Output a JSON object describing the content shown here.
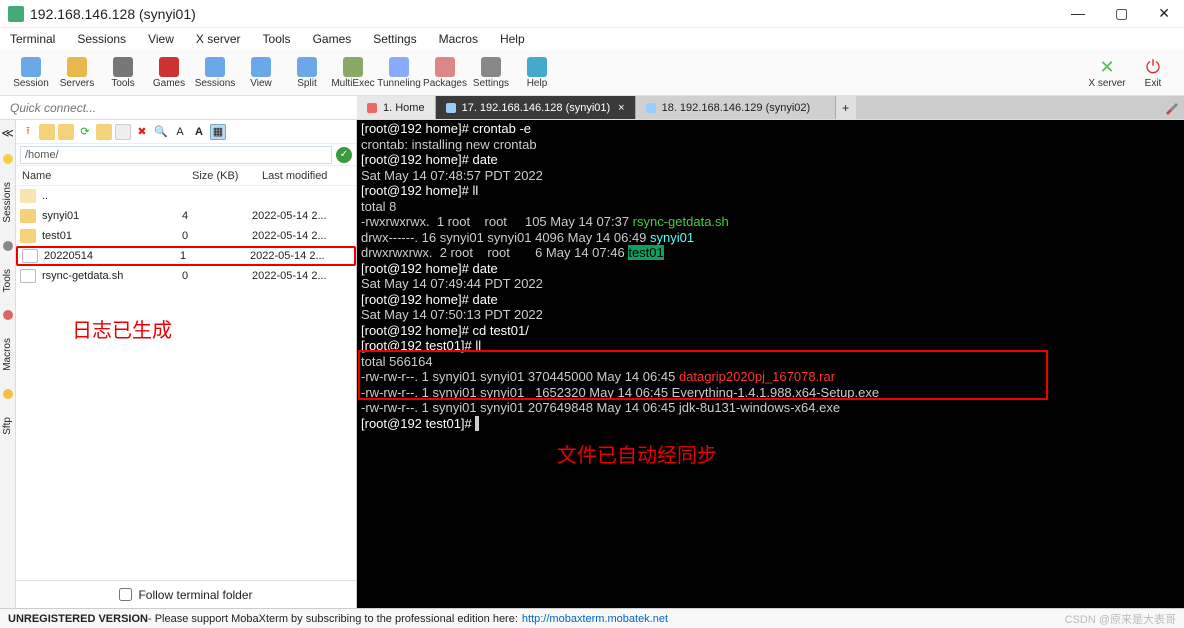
{
  "window": {
    "title": "192.168.146.128 (synyi01)"
  },
  "win_controls": {
    "min": "—",
    "max": "▢",
    "close": "✕"
  },
  "menu": {
    "terminal": "Terminal",
    "sessions": "Sessions",
    "view": "View",
    "xserver": "X server",
    "tools": "Tools",
    "games": "Games",
    "settings": "Settings",
    "macros": "Macros",
    "help": "Help"
  },
  "toolbar": {
    "items": [
      {
        "label": "Session",
        "color": "#6aa8e8"
      },
      {
        "label": "Servers",
        "color": "#e8b84a"
      },
      {
        "label": "Tools",
        "color": "#777"
      },
      {
        "label": "Games",
        "color": "#c33"
      },
      {
        "label": "Sessions",
        "color": "#6aa8e8"
      },
      {
        "label": "View",
        "color": "#6aa8e8"
      },
      {
        "label": "Split",
        "color": "#6aa8e8"
      },
      {
        "label": "MultiExec",
        "color": "#8a6"
      },
      {
        "label": "Tunneling",
        "color": "#8af"
      },
      {
        "label": "Packages",
        "color": "#d88"
      },
      {
        "label": "Settings",
        "color": "#888"
      },
      {
        "label": "Help",
        "color": "#4ac"
      }
    ],
    "right": [
      {
        "label": "X server",
        "color": "#5b5"
      },
      {
        "label": "Exit",
        "color": "#d33"
      }
    ]
  },
  "quick_connect": {
    "placeholder": "Quick connect..."
  },
  "tabs": {
    "home": "1. Home",
    "t1": "17. 192.168.146.128 (synyi01)",
    "t2": "18. 192.168.146.129  (synyi02)",
    "add": "+"
  },
  "side_tabs": {
    "a": "Sessions",
    "b": "Tools",
    "c": "Macros",
    "d": "Sftp"
  },
  "fp": {
    "path": "/home/",
    "head": {
      "name": "Name",
      "size": "Size (KB)",
      "mod": "Last modified"
    },
    "rows": [
      {
        "name": "..",
        "size": "",
        "mod": "",
        "type": "up"
      },
      {
        "name": "synyi01",
        "size": "4",
        "mod": "2022-05-14 2...",
        "type": "folder"
      },
      {
        "name": "test01",
        "size": "0",
        "mod": "2022-05-14 2...",
        "type": "folder"
      },
      {
        "name": "20220514",
        "size": "1",
        "mod": "2022-05-14 2...",
        "type": "file",
        "hl": true
      },
      {
        "name": "rsync-getdata.sh",
        "size": "0",
        "mod": "2022-05-14 2...",
        "type": "file"
      }
    ],
    "annot": "日志已生成",
    "follow": "Follow terminal folder"
  },
  "term": {
    "lines": [
      {
        "t": "[root@192 home]# crontab -e",
        "k": "p"
      },
      {
        "t": "crontab: installing new crontab"
      },
      {
        "t": "[root@192 home]# date",
        "k": "p"
      },
      {
        "t": "Sat May 14 07:48:57 PDT 2022"
      },
      {
        "t": "[root@192 home]# ll",
        "k": "p"
      },
      {
        "t": "total 8"
      },
      {
        "t": "-rwxrwxrwx.  1 root    root     105 May 14 07:37 ",
        "a": "rsync-getdata.sh",
        "ak": "gr"
      },
      {
        "t": "drwx------. 16 synyi01 synyi01 4096 May 14 06:49 ",
        "a": "synyi01",
        "ak": "cy"
      },
      {
        "t": "drwxrwxrwx.  2 root    root       6 May 14 07:46 ",
        "a": "test01",
        "ak": "hl"
      },
      {
        "t": "[root@192 home]# date",
        "k": "p"
      },
      {
        "t": "Sat May 14 07:49:44 PDT 2022"
      },
      {
        "t": "[root@192 home]# date",
        "k": "p"
      },
      {
        "t": "Sat May 14 07:50:13 PDT 2022"
      },
      {
        "t": "[root@192 home]# cd test01/",
        "k": "p"
      },
      {
        "t": "[root@192 test01]# ll",
        "k": "p"
      },
      {
        "t": "total 566164"
      },
      {
        "t": "-rw-rw-r--. 1 synyi01 synyi01 370445000 May 14 06:45 ",
        "a": "datagrip2020pj_167078.rar",
        "ak": "rd"
      },
      {
        "t": "-rw-rw-r--. 1 synyi01 synyi01   1652320 May 14 06:45 Everything-1.4.1.988.x64-Setup.exe"
      },
      {
        "t": "-rw-rw-r--. 1 synyi01 synyi01 207649848 May 14 06:45 jdk-8u131-windows-x64.exe"
      },
      {
        "t": "[root@192 test01]# ",
        "k": "p",
        "cursor": true
      }
    ],
    "annot": "文件已自动经同步"
  },
  "status": {
    "unreg": "UNREGISTERED VERSION",
    "msg": " -  Please support MobaXterm by subscribing to the professional edition here:  ",
    "link": "http://mobaxterm.mobatek.net",
    "watermark": "CSDN @原来是大表哥"
  }
}
